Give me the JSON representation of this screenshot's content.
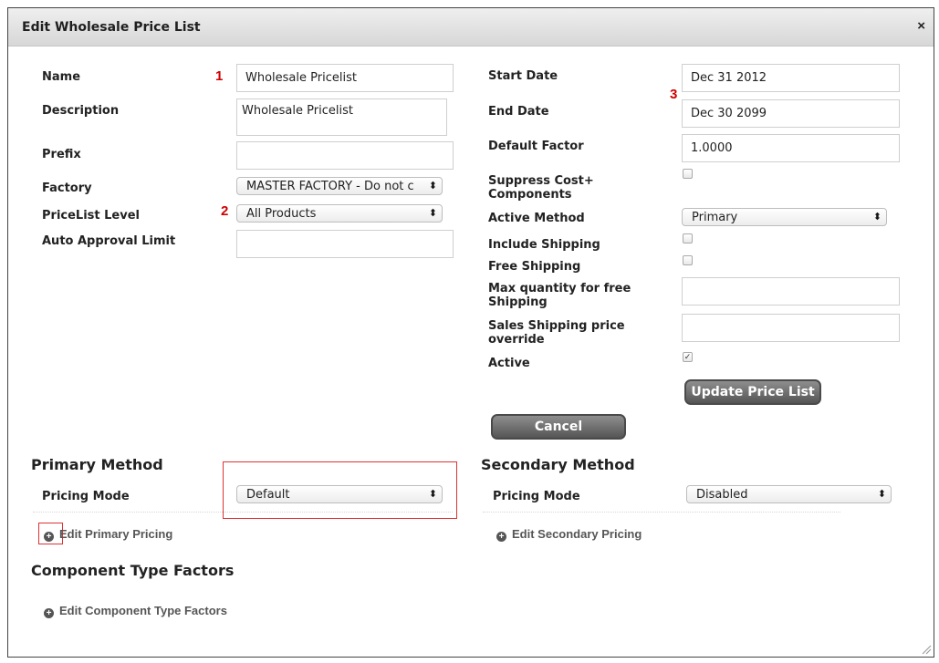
{
  "dialog": {
    "title": "Edit Wholesale Price List",
    "close_label": "×"
  },
  "annotations": {
    "n1": "1",
    "n2": "2",
    "n3": "3"
  },
  "left": {
    "name_label": "Name",
    "name_value": "Wholesale Pricelist",
    "description_label": "Description",
    "description_value": "Wholesale Pricelist",
    "prefix_label": "Prefix",
    "prefix_value": "",
    "factory_label": "Factory",
    "factory_value": "MASTER FACTORY - Do not c",
    "pricelist_level_label": "PriceList Level",
    "pricelist_level_value": "All Products",
    "auto_approval_label": "Auto Approval Limit",
    "auto_approval_value": ""
  },
  "right": {
    "start_date_label": "Start Date",
    "start_date_value": "Dec 31 2012",
    "end_date_label": "End Date",
    "end_date_value": "Dec 30 2099",
    "default_factor_label": "Default Factor",
    "default_factor_value": "1.0000",
    "suppress_label_1": "Suppress Cost+",
    "suppress_label_2": "Components",
    "suppress_checked": false,
    "active_method_label": "Active Method",
    "active_method_value": "Primary",
    "include_shipping_label": "Include Shipping",
    "include_shipping_checked": false,
    "free_shipping_label": "Free Shipping",
    "free_shipping_checked": false,
    "max_qty_label_1": "Max quantity for free",
    "max_qty_label_2": "Shipping",
    "max_qty_value": "",
    "sales_override_label_1": "Sales Shipping price",
    "sales_override_label_2": "override",
    "sales_override_value": "",
    "active_label": "Active",
    "active_checked": true,
    "active_check_glyph": "✓"
  },
  "buttons": {
    "update": "Update Price List",
    "cancel": "Cancel"
  },
  "primary": {
    "heading": "Primary Method",
    "pricing_mode_label": "Pricing Mode",
    "pricing_mode_value": "Default",
    "edit_link": "Edit Primary Pricing"
  },
  "secondary": {
    "heading": "Secondary Method",
    "pricing_mode_label": "Pricing Mode",
    "pricing_mode_value": "Disabled",
    "edit_link": "Edit Secondary Pricing"
  },
  "component": {
    "heading": "Component Type Factors",
    "edit_link": "Edit Component Type Factors"
  },
  "icons": {
    "select_arrow": "⬍",
    "plus": "+",
    "close": "close-icon",
    "add": "plus-circle-icon",
    "resize": "resize-grip-icon",
    "check": "checkmark-icon"
  },
  "colors": {
    "annotation_red": "#d00000",
    "button_gray": "#555555"
  }
}
